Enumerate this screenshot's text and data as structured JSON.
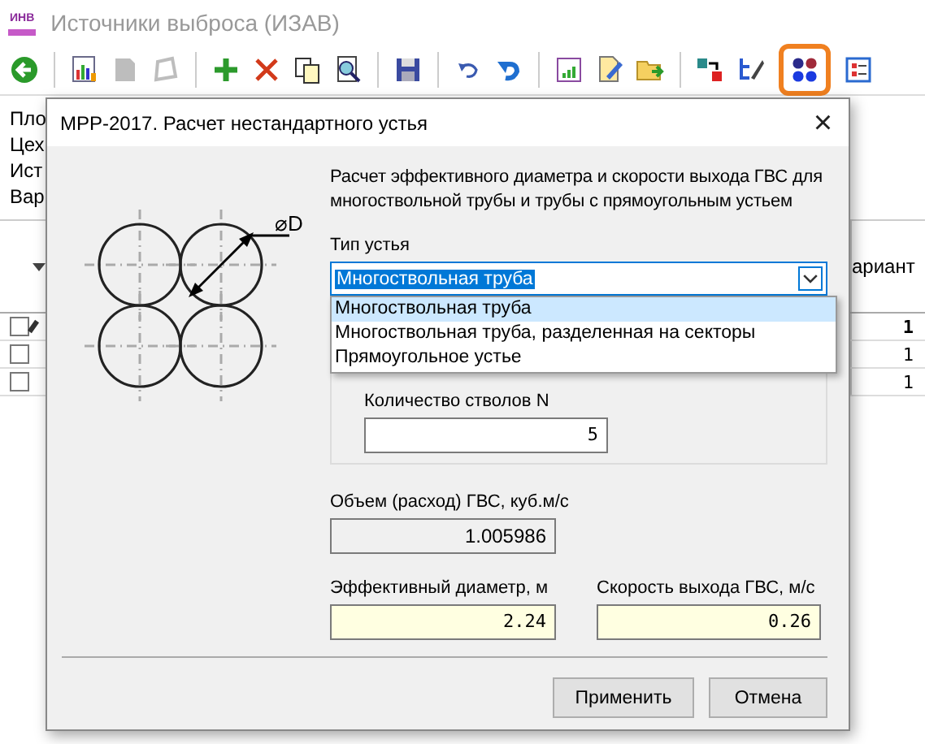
{
  "app": {
    "logo": "ИНВ",
    "title": "Источники выброса (ИЗАВ)",
    "toolbar_groups": [
      [
        {
          "kind": "back",
          "selected": false,
          "disabled": false
        }
      ],
      [
        {
          "kind": "chart",
          "selected": false,
          "disabled": false
        },
        {
          "kind": "page",
          "selected": false,
          "disabled": true
        },
        {
          "kind": "shape",
          "selected": false,
          "disabled": true
        }
      ],
      [
        {
          "kind": "plus",
          "selected": false,
          "disabled": false
        },
        {
          "kind": "cross",
          "selected": false,
          "disabled": false
        },
        {
          "kind": "copy",
          "selected": false,
          "disabled": false
        },
        {
          "kind": "find",
          "selected": false,
          "disabled": false
        }
      ],
      [
        {
          "kind": "save",
          "selected": false,
          "disabled": false
        }
      ],
      [
        {
          "kind": "undo",
          "selected": false,
          "disabled": false
        },
        {
          "kind": "redo",
          "selected": false,
          "disabled": false
        }
      ],
      [
        {
          "kind": "report",
          "selected": false,
          "disabled": false
        },
        {
          "kind": "edit",
          "selected": false,
          "disabled": false
        },
        {
          "kind": "folder",
          "selected": false,
          "disabled": false
        }
      ],
      [
        {
          "kind": "swap",
          "selected": false,
          "disabled": false
        },
        {
          "kind": "tree",
          "selected": false,
          "disabled": false
        },
        {
          "kind": "dots",
          "selected": true,
          "disabled": false
        },
        {
          "kind": "form",
          "selected": false,
          "disabled": false
        }
      ]
    ],
    "form_labels": [
      "Пло",
      "Цех",
      "Ист",
      "Вар"
    ],
    "table": {
      "column": "ариант",
      "rows": [
        {
          "checked": false,
          "current": true,
          "value": "1",
          "bold": true
        },
        {
          "checked": false,
          "current": false,
          "value": "1",
          "bold": false
        },
        {
          "checked": false,
          "current": false,
          "value": "1",
          "bold": false
        }
      ]
    }
  },
  "dialog": {
    "title": "МРР-2017. Расчет нестандартного устья",
    "close": "×",
    "diagram_label": "⌀D",
    "description": "Расчет эффективного диаметра и скорости выхода ГВС для многоствольной трубы и трубы с прямоугольным устьем",
    "type_label": "Тип устья",
    "type_value": "Многоствольная труба",
    "options": [
      {
        "label": "Многоствольная труба",
        "selected": true
      },
      {
        "label": "Многоствольная труба, разделенная на секторы",
        "selected": false
      },
      {
        "label": "Прямоугольное устье",
        "selected": false
      }
    ],
    "count_label": "Количество стволов N",
    "count_value": "5",
    "volume_label": "Объем (расход) ГВС, куб.м/с",
    "volume_value": "1.005986",
    "diameter_label": "Эффективный диаметр, м",
    "diameter_value": "2.24",
    "speed_label": "Скорость выхода ГВС, м/с",
    "speed_value": "0.26",
    "buttons": [
      "Применить",
      "Отмена"
    ]
  }
}
